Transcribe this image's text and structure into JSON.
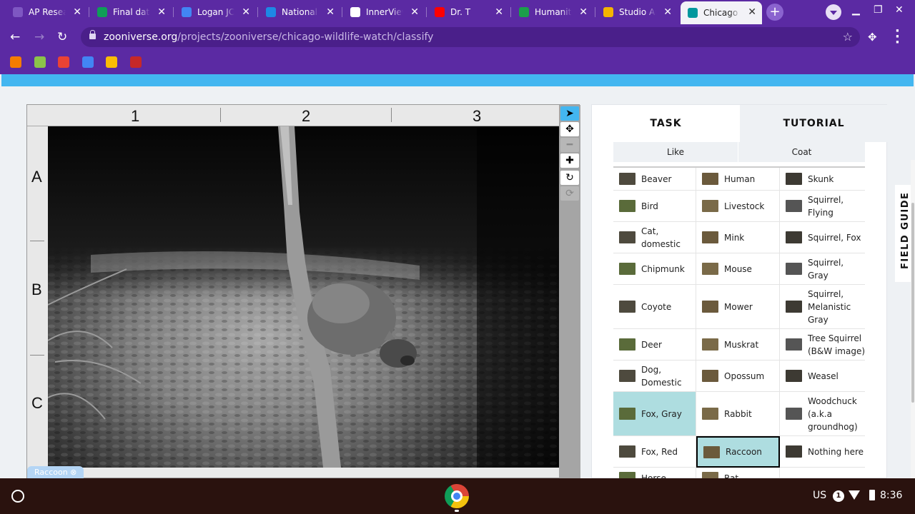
{
  "browser": {
    "tabs": [
      {
        "label": "AP Resea",
        "icon": "list-icon",
        "color": "#7e57c2"
      },
      {
        "label": "Final data",
        "icon": "sheets-plus-icon",
        "color": "#0f9d58"
      },
      {
        "label": "Logan JC",
        "icon": "docs-icon",
        "color": "#4285f4"
      },
      {
        "label": "National",
        "icon": "classroom-icon",
        "color": "#1e88e5"
      },
      {
        "label": "InnerView",
        "icon": "innerview-icon",
        "color": "#ffffff"
      },
      {
        "label": "Dr. T",
        "icon": "youtube-icon",
        "color": "#ff0000"
      },
      {
        "label": "Humaniti",
        "icon": "humanities-icon",
        "color": "#1b9e4b"
      },
      {
        "label": "Studio Ar",
        "icon": "slides-icon",
        "color": "#f4b400"
      },
      {
        "label": "Chicago",
        "icon": "zooniverse-icon",
        "color": "#00979d"
      }
    ],
    "url_host": "zooniverse.org",
    "url_path": "/projects/zooniverse/chicago-wildlife-watch/classify",
    "bookmarks": [
      {
        "icon": "bookmark-calendar-icon",
        "color": "#f57c00"
      },
      {
        "icon": "bookmark-photos-icon",
        "color": "#8bc34a"
      },
      {
        "icon": "gmail-icon",
        "color": "#ea4335"
      },
      {
        "icon": "docs-icon",
        "color": "#4285f4"
      },
      {
        "icon": "drive-icon",
        "color": "#fbbc05"
      },
      {
        "icon": "bookmark-w-icon",
        "color": "#c62828"
      }
    ]
  },
  "viewer": {
    "ruler_columns": [
      "1",
      "2",
      "3"
    ],
    "ruler_rows": [
      "A",
      "B",
      "C"
    ],
    "tools": [
      "pointer-icon",
      "move-icon",
      "zoom-out-icon",
      "zoom-in-icon",
      "rotate-icon",
      "reset-icon"
    ],
    "selected_chip": "Raccoon ⊗"
  },
  "panel": {
    "tabs": {
      "task": "TASK",
      "tutorial": "TUTORIAL"
    },
    "filters": [
      "Like",
      "Coat"
    ],
    "choices": [
      [
        "Beaver",
        "Human",
        "Skunk"
      ],
      [
        "Bird",
        "Livestock",
        "Squirrel, Flying"
      ],
      [
        "Cat, domestic",
        "Mink",
        "Squirrel, Fox"
      ],
      [
        "Chipmunk",
        "Mouse",
        "Squirrel, Gray"
      ],
      [
        "Coyote",
        "Mower",
        "Squirrel, Melanistic Gray"
      ],
      [
        "Deer",
        "Muskrat",
        "Tree Squirrel (B&W image)"
      ],
      [
        "Dog, Domestic",
        "Opossum",
        "Weasel"
      ],
      [
        "Fox, Gray",
        "Rabbit",
        "Woodchuck (a.k.a groundhog)"
      ],
      [
        "Fox, Red",
        "Raccoon",
        "Nothing here"
      ],
      [
        "Horse",
        "Rat",
        ""
      ]
    ],
    "highlighted_choice": "Fox, Gray",
    "selected_choice": "Raccoon",
    "field_guide": "FIELD GUIDE"
  },
  "shelf": {
    "input_method": "US",
    "notification_count": "1",
    "time": "8:36"
  }
}
